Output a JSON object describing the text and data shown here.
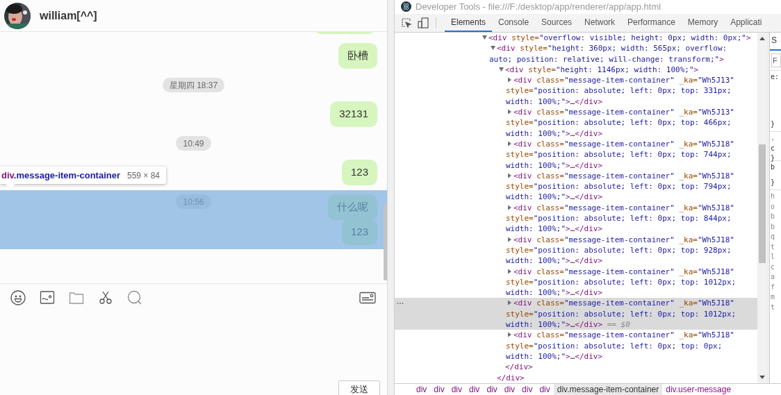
{
  "chat": {
    "contact_name": "william[^^]",
    "messages": [
      {
        "kind": "bubble",
        "text": "卧槽"
      },
      {
        "kind": "time",
        "text": "星期四 18:37"
      },
      {
        "kind": "bubble",
        "text": "32131"
      },
      {
        "kind": "time",
        "text": "10:49"
      },
      {
        "kind": "bubble",
        "text": "123"
      }
    ],
    "inspected_group": {
      "time": "10:56",
      "bubbles": [
        "什么呢",
        "123"
      ]
    },
    "inspector_tooltip": {
      "tag": "div",
      "class_name": ".message-item-container",
      "size": "559 × 84"
    },
    "send_button": "发送"
  },
  "devtools": {
    "title": "Developer Tools - file:///F:/desktop/app/renderer/app/app.html",
    "tabs": [
      {
        "label": "Elements",
        "selected": true
      },
      {
        "label": "Console",
        "selected": false
      },
      {
        "label": "Sources",
        "selected": false
      },
      {
        "label": "Network",
        "selected": false
      },
      {
        "label": "Performance",
        "selected": false
      },
      {
        "label": "Memory",
        "selected": false
      },
      {
        "label": "Applicati",
        "selected": false
      }
    ],
    "tree": [
      {
        "open": "<div",
        "attributes": [
          {
            "name": "style=",
            "value": "\"overflow: visible; height: 0px; width: 0px;\""
          }
        ],
        "open_end": ">",
        "expanded": true,
        "selected": false,
        "children": [
          {
            "open": "<div",
            "attributes": [
              {
                "name": "style=",
                "value": "\"height: 360px; width: 565px; overflow: auto; position: relative; will-change: transform;\""
              }
            ],
            "open_end": ">",
            "expanded": true,
            "selected": false,
            "closing": "</div>",
            "children": [
              {
                "open": "<div",
                "attributes": [
                  {
                    "name": "style=",
                    "value": "\"height: 1146px; width: 100%;\""
                  }
                ],
                "open_end": ">",
                "expanded": true,
                "selected": false,
                "closing": "</div>",
                "children": [
                  {
                    "open": "<div",
                    "attributes": [
                      {
                        "name": "class=",
                        "value": "\"message-item-container\""
                      },
                      {
                        "name": "_ka=",
                        "value": "\"Wh5J13\""
                      },
                      {
                        "name": "style=",
                        "value": "\"position: absolute; left: 0px; top: 331px; width: 100%;\""
                      }
                    ],
                    "open_end": ">",
                    "expanded": false,
                    "selected": false,
                    "ellipsis": "…",
                    "closing": "</div>"
                  },
                  {
                    "open": "<div",
                    "attributes": [
                      {
                        "name": "class=",
                        "value": "\"message-item-container\""
                      },
                      {
                        "name": "_ka=",
                        "value": "\"Wh5J13\""
                      },
                      {
                        "name": "style=",
                        "value": "\"position: absolute; left: 0px; top: 466px; width: 100%;\""
                      }
                    ],
                    "open_end": ">",
                    "expanded": false,
                    "selected": false,
                    "ellipsis": "…",
                    "closing": "</div>"
                  },
                  {
                    "open": "<div",
                    "attributes": [
                      {
                        "name": "class=",
                        "value": "\"message-item-container\""
                      },
                      {
                        "name": "_ka=",
                        "value": "\"Wh5J18\""
                      },
                      {
                        "name": "style=",
                        "value": "\"position: absolute; left: 0px; top: 744px; width: 100%;\""
                      }
                    ],
                    "open_end": ">",
                    "expanded": false,
                    "selected": false,
                    "ellipsis": "…",
                    "closing": "</div>"
                  },
                  {
                    "open": "<div",
                    "attributes": [
                      {
                        "name": "class=",
                        "value": "\"message-item-container\""
                      },
                      {
                        "name": "_ka=",
                        "value": "\"Wh5J18\""
                      },
                      {
                        "name": "style=",
                        "value": "\"position: absolute; left: 0px; top: 794px; width: 100%;\""
                      }
                    ],
                    "open_end": ">",
                    "expanded": false,
                    "selected": false,
                    "ellipsis": "…",
                    "closing": "</div>"
                  },
                  {
                    "open": "<div",
                    "attributes": [
                      {
                        "name": "class=",
                        "value": "\"message-item-container\""
                      },
                      {
                        "name": "_ka=",
                        "value": "\"Wh5J18\""
                      },
                      {
                        "name": "style=",
                        "value": "\"position: absolute; left: 0px; top: 844px; width: 100%;\""
                      }
                    ],
                    "open_end": ">",
                    "expanded": false,
                    "selected": false,
                    "ellipsis": "…",
                    "closing": "</div>"
                  },
                  {
                    "open": "<div",
                    "attributes": [
                      {
                        "name": "class=",
                        "value": "\"message-item-container\""
                      },
                      {
                        "name": "_ka=",
                        "value": "\"Wh5J18\""
                      },
                      {
                        "name": "style=",
                        "value": "\"position: absolute; left: 0px; top: 928px; width: 100%;\""
                      }
                    ],
                    "open_end": ">",
                    "expanded": false,
                    "selected": false,
                    "ellipsis": "…",
                    "closing": "</div>"
                  },
                  {
                    "open": "<div",
                    "attributes": [
                      {
                        "name": "class=",
                        "value": "\"message-item-container\""
                      },
                      {
                        "name": "_ka=",
                        "value": "\"Wh5J18\""
                      },
                      {
                        "name": "style=",
                        "value": "\"position: absolute; left: 0px; top: 1012px; width: 100%;\""
                      }
                    ],
                    "open_end": ">",
                    "expanded": false,
                    "selected": false,
                    "ellipsis": "…",
                    "closing": "</div>"
                  },
                  {
                    "open": "<div",
                    "attributes": [
                      {
                        "name": "class=",
                        "value": "\"message-item-container\""
                      },
                      {
                        "name": "_ka=",
                        "value": "\"Wh5J18\""
                      },
                      {
                        "name": "style=",
                        "value": "\"position: absolute; left: 0px; top: 1012px; width: 100%;\""
                      }
                    ],
                    "open_end": ">",
                    "expanded": false,
                    "selected": true,
                    "ellipsis": "…",
                    "closing": "</div>",
                    "console_ref": "== $0"
                  },
                  {
                    "open": "<div",
                    "attributes": [
                      {
                        "name": "class=",
                        "value": "\"message-item-container\""
                      },
                      {
                        "name": "_ka=",
                        "value": "\"Wh5J18\""
                      },
                      {
                        "name": "style=",
                        "value": "\"position: absolute; left: 0px; top: 0px; width: 100%;\""
                      }
                    ],
                    "open_end": ">",
                    "expanded": false,
                    "selected": false,
                    "ellipsis": "…",
                    "closing": "</div>"
                  }
                ]
              }
            ]
          }
        ]
      }
    ],
    "breadcrumbs": [
      {
        "label": "div",
        "selected": false
      },
      {
        "label": "div",
        "selected": false
      },
      {
        "label": "div",
        "selected": false
      },
      {
        "label": "div",
        "selected": false
      },
      {
        "label": "div",
        "selected": false
      },
      {
        "label": "div",
        "selected": false
      },
      {
        "label": "div",
        "selected": false
      },
      {
        "label": "div",
        "selected": false
      },
      {
        "label": "div.message-item-container",
        "selected": true
      },
      {
        "label": "div.user-message",
        "selected": false
      }
    ],
    "styles_pane": {
      "tab": "S",
      "filter_placeholder": "F",
      "sections": [
        {
          "lines": [
            "e:"
          ],
          "close": "}"
        },
        {
          "lines": [
            ".",
            "c"
          ],
          "close": "}"
        },
        {
          "lines": [
            "b"
          ],
          "close": "}"
        },
        {
          "lines": [
            "h",
            "o",
            "b",
            "b",
            "q",
            "t",
            "l",
            "c",
            "a",
            "f",
            "m",
            "t"
          ]
        }
      ]
    }
  }
}
